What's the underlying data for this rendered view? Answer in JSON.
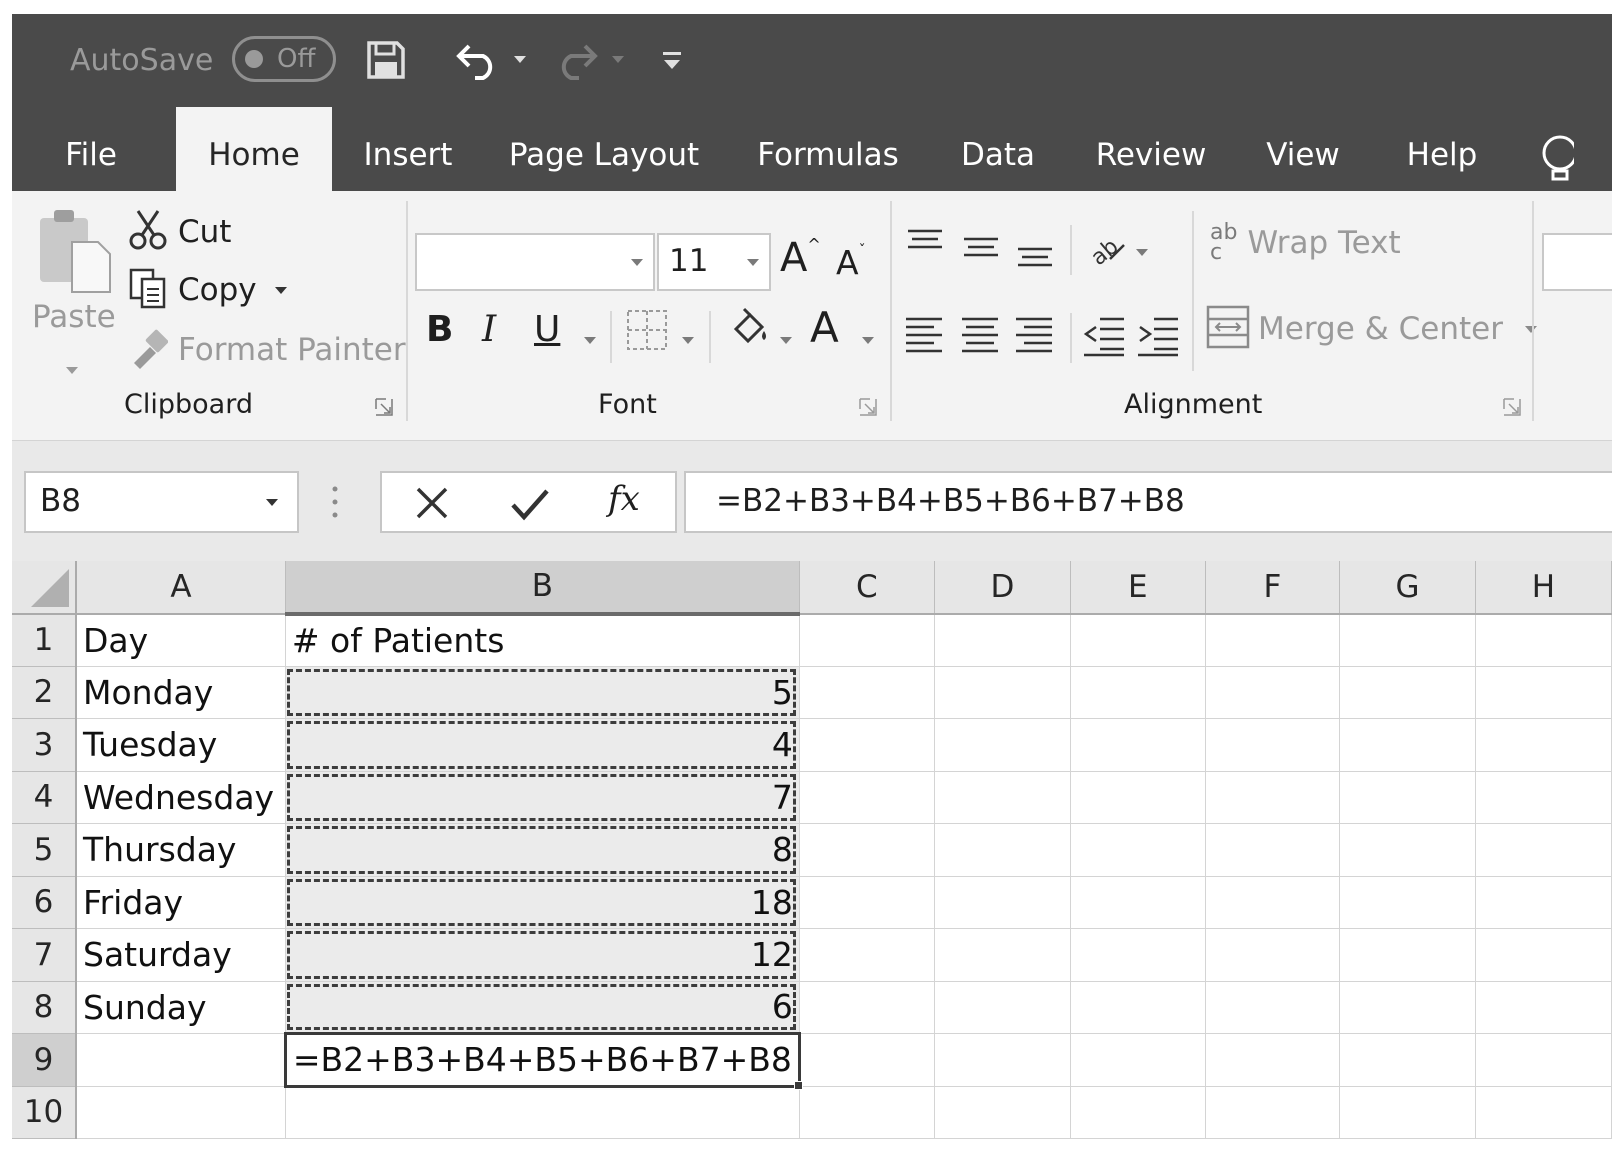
{
  "title_bar": {
    "autosave_label": "AutoSave",
    "autosave_state": "Off"
  },
  "tabs": [
    {
      "label": "File"
    },
    {
      "label": "Home",
      "active": true
    },
    {
      "label": "Insert"
    },
    {
      "label": "Page Layout"
    },
    {
      "label": "Formulas"
    },
    {
      "label": "Data"
    },
    {
      "label": "Review"
    },
    {
      "label": "View"
    },
    {
      "label": "Help"
    }
  ],
  "ribbon": {
    "clipboard": {
      "group_label": "Clipboard",
      "paste": "Paste",
      "cut": "Cut",
      "copy": "Copy",
      "format_painter": "Format Painter"
    },
    "font": {
      "group_label": "Font",
      "font_name": "",
      "font_size": "11",
      "bold": "B",
      "italic": "I",
      "underline": "U",
      "grow": "A",
      "shrink": "A",
      "font_color": "A"
    },
    "alignment": {
      "group_label": "Alignment",
      "wrap_text": "Wrap Text",
      "merge_center": "Merge & Center",
      "wrap_glyph_top": "ab",
      "wrap_glyph_bottom": "c"
    }
  },
  "formula_bar": {
    "name_box": "B8",
    "fx": "fx",
    "formula": "=B2+B3+B4+B5+B6+B7+B8"
  },
  "sheet": {
    "columns": [
      "A",
      "B",
      "C",
      "D",
      "E",
      "F",
      "G",
      "H"
    ],
    "selected_column": "B",
    "rows": [
      {
        "num": "1",
        "a": "Day",
        "b": "# of Patients"
      },
      {
        "num": "2",
        "a": "Monday",
        "b": "5"
      },
      {
        "num": "3",
        "a": "Tuesday",
        "b": "4"
      },
      {
        "num": "4",
        "a": "Wednesday",
        "b": "7"
      },
      {
        "num": "5",
        "a": "Thursday",
        "b": "8"
      },
      {
        "num": "6",
        "a": "Friday",
        "b": "18"
      },
      {
        "num": "7",
        "a": "Saturday",
        "b": "12"
      },
      {
        "num": "8",
        "a": "Sunday",
        "b": "6"
      },
      {
        "num": "9",
        "a": "",
        "b": "=B2+B3+B4+B5+B6+B7+B8"
      },
      {
        "num": "10",
        "a": "",
        "b": ""
      }
    ]
  },
  "colors": {
    "title_bar_bg": "#4a4a4a",
    "ribbon_bg": "#f3f3f3",
    "header_bg": "#e6e6e6",
    "selected_header_bg": "#cfcfcf"
  }
}
